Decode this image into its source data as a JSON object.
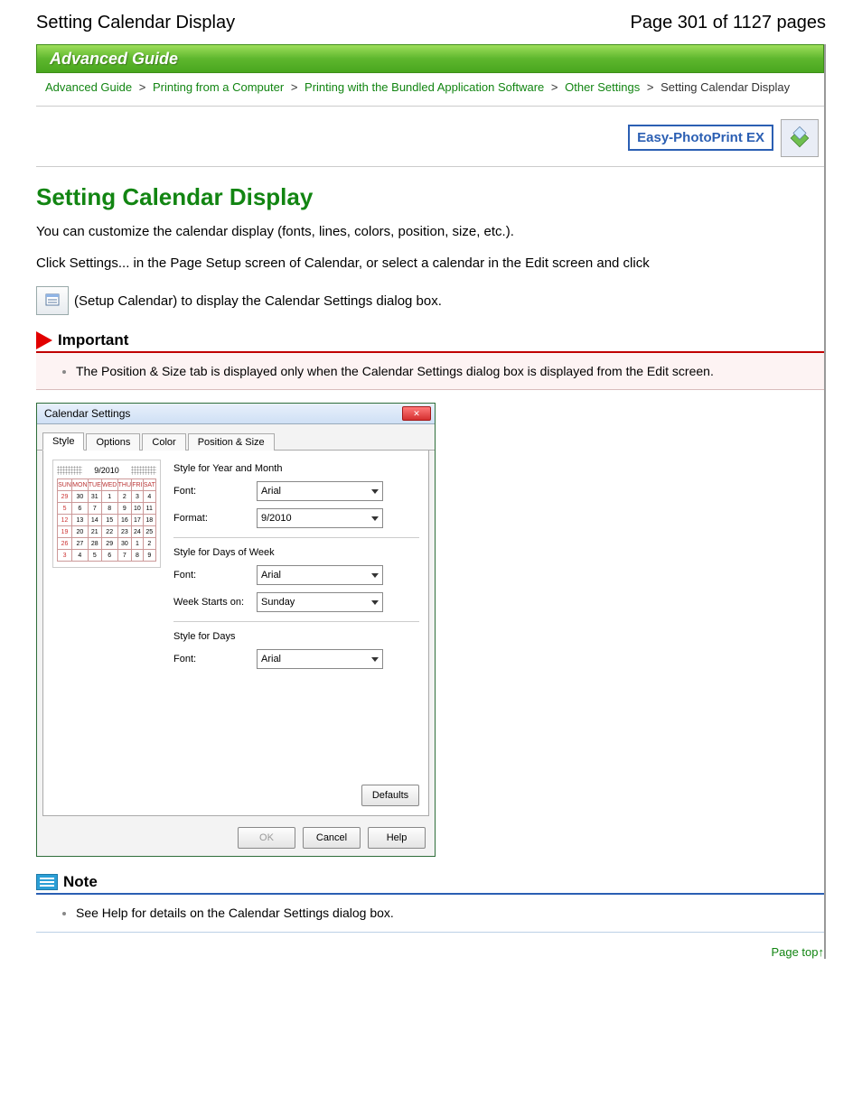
{
  "header": {
    "doc_title": "Setting Calendar Display",
    "page_indicator": "Page 301 of 1127 pages"
  },
  "band_title": "Advanced Guide",
  "breadcrumb": {
    "items": [
      "Advanced Guide",
      "Printing from a Computer",
      "Printing with the Bundled Application Software",
      "Other Settings"
    ],
    "sep": ">",
    "current": "Setting Calendar Display"
  },
  "badge": {
    "product": "Easy-PhotoPrint EX"
  },
  "main": {
    "heading": "Setting Calendar Display",
    "intro": "You can customize the calendar display (fonts, lines, colors, position, size, etc.).",
    "instr_line": "Click Settings... in the Page Setup screen of Calendar, or select a calendar in the Edit screen and click",
    "instr_tail": "(Setup Calendar) to display the Calendar Settings dialog box."
  },
  "important": {
    "label": "Important",
    "text": "The Position & Size tab is displayed only when the Calendar Settings dialog box is displayed from the Edit screen."
  },
  "dialog": {
    "title": "Calendar Settings",
    "close": "✕",
    "tabs": [
      "Style",
      "Options",
      "Color",
      "Position & Size"
    ],
    "active_tab": 0,
    "preview_month": "9/2010",
    "cal_header": [
      "SUN",
      "MON",
      "TUE",
      "WED",
      "THU",
      "FRI",
      "SAT"
    ],
    "cal_rows": [
      [
        "29",
        "30",
        "31",
        "1",
        "2",
        "3",
        "4"
      ],
      [
        "5",
        "6",
        "7",
        "8",
        "9",
        "10",
        "11"
      ],
      [
        "12",
        "13",
        "14",
        "15",
        "16",
        "17",
        "18"
      ],
      [
        "19",
        "20",
        "21",
        "22",
        "23",
        "24",
        "25"
      ],
      [
        "26",
        "27",
        "28",
        "29",
        "30",
        "1",
        "2"
      ],
      [
        "3",
        "4",
        "5",
        "6",
        "7",
        "8",
        "9"
      ]
    ],
    "groups": {
      "ym": {
        "title": "Style for Year and Month",
        "font_label": "Font:",
        "font_value": "Arial",
        "format_label": "Format:",
        "format_value": "9/2010"
      },
      "dow": {
        "title": "Style for Days of Week",
        "font_label": "Font:",
        "font_value": "Arial",
        "week_label": "Week Starts on:",
        "week_value": "Sunday"
      },
      "days": {
        "title": "Style for Days",
        "font_label": "Font:",
        "font_value": "Arial"
      }
    },
    "buttons": {
      "defaults": "Defaults",
      "ok": "OK",
      "cancel": "Cancel",
      "help": "Help"
    }
  },
  "note": {
    "label": "Note",
    "text": "See Help for details on the Calendar Settings dialog box."
  },
  "page_top": {
    "label": "Page top",
    "arrow": "↑"
  }
}
